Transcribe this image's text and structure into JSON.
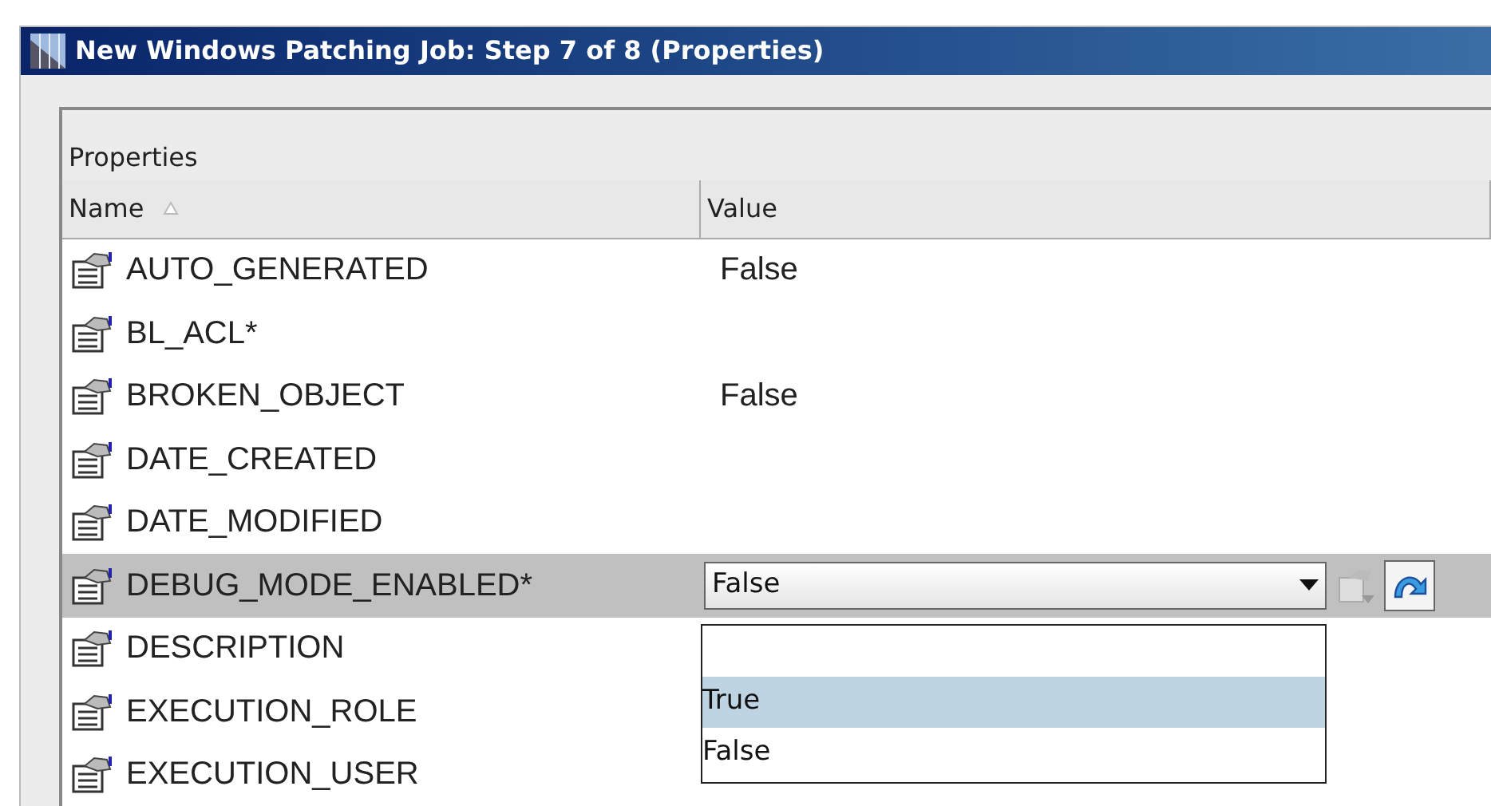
{
  "window": {
    "title": "New Windows Patching Job: Step 7 of 8 (Properties)"
  },
  "section": {
    "title": "Properties"
  },
  "columns": [
    {
      "label": "Name"
    },
    {
      "label": "Value"
    }
  ],
  "rows": [
    {
      "name": "AUTO_GENERATED",
      "value": "False",
      "selected": false
    },
    {
      "name": "BL_ACL*",
      "selected": false
    },
    {
      "name": "BROKEN_OBJECT",
      "value": "False",
      "selected": false
    },
    {
      "name": "DATE_CREATED",
      "selected": false
    },
    {
      "name": "DATE_MODIFIED",
      "selected": false
    },
    {
      "name": "DEBUG_MODE_ENABLED*",
      "editor": {
        "value": "False",
        "expanded": true,
        "options": [
          {
            "label": "True",
            "highlighted": true
          },
          {
            "label": "False",
            "highlighted": false
          }
        ]
      },
      "selected": true
    },
    {
      "name": "DESCRIPTION",
      "selected": false
    },
    {
      "name": "EXECUTION_ROLE",
      "selected": false
    },
    {
      "name": "EXECUTION_USER",
      "selected": false
    }
  ]
}
